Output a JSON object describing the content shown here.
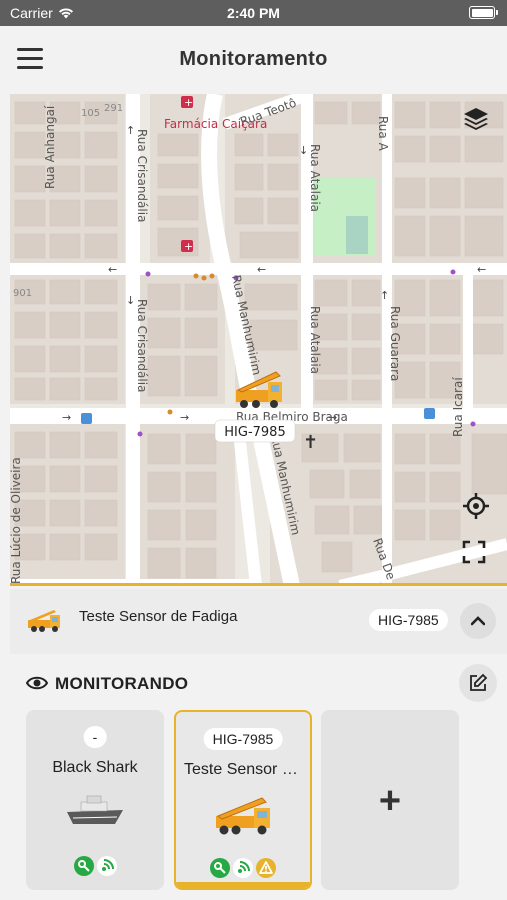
{
  "status_bar": {
    "carrier": "Carrier",
    "time": "2:40 PM"
  },
  "header": {
    "title": "Monitoramento",
    "menu_icon": "hamburger-menu-icon"
  },
  "map": {
    "streets": {
      "rua_anhangai": "Rua Anhangaí",
      "rua_crisandalia_top": "Rua Crisandália",
      "rua_crisandalia_bottom": "Rua Crisandália",
      "rua_teotonio": "Rua Teotô",
      "rua_atalaia_top": "Rua Atalaia",
      "rua_atalaia_bottom": "Rua Atalaia",
      "rua_manhumirim_top": "Rua Manhumirim",
      "rua_manhumirim_bottom": "Rua Manhumirim",
      "rua_guarara": "Rua Guarara",
      "rua_icarai": "Rua Icaraí",
      "rua_belmiro_braga": "Rua Belmiro Braga",
      "rua_lucio_de_oliveira": "Rua Lúcio de Oliveira",
      "rua_de": "Rua De",
      "rua_a": "Rua A"
    },
    "poi": {
      "pharmacy": "Farmácia Caiçara"
    },
    "house_numbers": [
      "105",
      "291",
      "901"
    ],
    "vehicle_label": "HIG-7985",
    "colors": {
      "street": "#ffffff",
      "block": "#e4ddd5",
      "building": "#d9d0c9",
      "park": "#c8f0c6",
      "accent": "#e6b32b"
    }
  },
  "selected": {
    "name": "Teste Sensor de Fadiga",
    "plate": "HIG-7985"
  },
  "monitor": {
    "heading": "MONITORANDO",
    "cards": [
      {
        "plate": "-",
        "name": "Black Shark",
        "vehicle_icon": "boat-icon",
        "status_icons": [
          "key-icon",
          "signal-icon"
        ]
      },
      {
        "plate": "HIG-7985",
        "name": "Teste Sensor de Fadiga",
        "vehicle_icon": "crane-truck-icon",
        "status_icons": [
          "key-icon",
          "signal-icon",
          "warning-icon"
        ]
      }
    ],
    "add_label": "+"
  }
}
